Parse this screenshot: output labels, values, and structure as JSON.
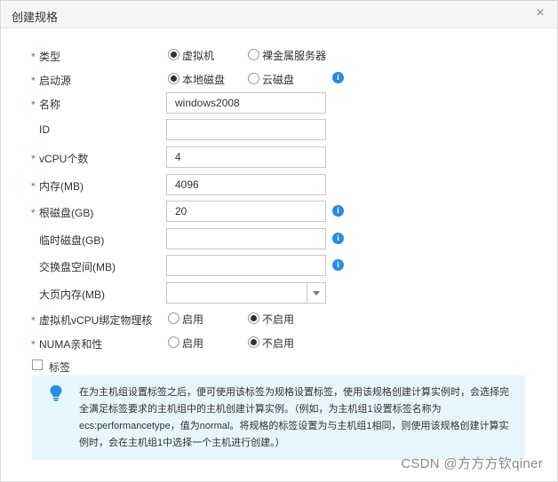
{
  "dialog": {
    "title": "创建规格",
    "close_symbol": "×"
  },
  "form": {
    "type": {
      "label": "类型",
      "options": [
        "虚拟机",
        "裸金属服务器"
      ],
      "selected": "虚拟机"
    },
    "boot_source": {
      "label": "启动源",
      "options": [
        "本地磁盘",
        "云磁盘"
      ],
      "selected": "本地磁盘"
    },
    "name": {
      "label": "名称",
      "value": "windows2008"
    },
    "id": {
      "label": "ID",
      "value": ""
    },
    "vcpu": {
      "label": "vCPU个数",
      "value": "4"
    },
    "memory": {
      "label": "内存(MB)",
      "value": "4096"
    },
    "root_disk": {
      "label": "根磁盘(GB)",
      "value": "20"
    },
    "temp_disk": {
      "label": "临时磁盘(GB)",
      "value": ""
    },
    "swap": {
      "label": "交换盘空间(MB)",
      "value": ""
    },
    "hugepage": {
      "label": "大页内存(MB)",
      "value": ""
    },
    "vcpu_binding": {
      "label": "虚拟机vCPU绑定物理核",
      "options": [
        "启用",
        "不启用"
      ],
      "selected": "不启用"
    },
    "numa": {
      "label": "NUMA亲和性",
      "options": [
        "启用",
        "不启用"
      ],
      "selected": "不启用"
    },
    "tags": {
      "label": "标签",
      "checked": false
    }
  },
  "tip": {
    "text": "在为主机组设置标签之后，便可使用该标签为规格设置标签，使用该规格创建计算实例时，会选择完全满足标签要求的主机组中的主机创建计算实例。（例如，为主机组1设置标签名称为ecs:performancetype，值为normal。将规格的标签设置为与主机组1相同，则使用该规格创建计算实例时，会在主机组1中选择一个主机进行创建。）"
  },
  "watermark": "CSDN @方方方钦qiner",
  "colors": {
    "required": "#e4393c",
    "info": "#2a8be6",
    "tip_background": "#e7f5fd",
    "header_background": "#f5f5f5"
  },
  "icons": {
    "close": "close-icon",
    "info": "info-icon",
    "tip": "lightbulb-icon",
    "dropdown": "chevron-down-icon"
  }
}
